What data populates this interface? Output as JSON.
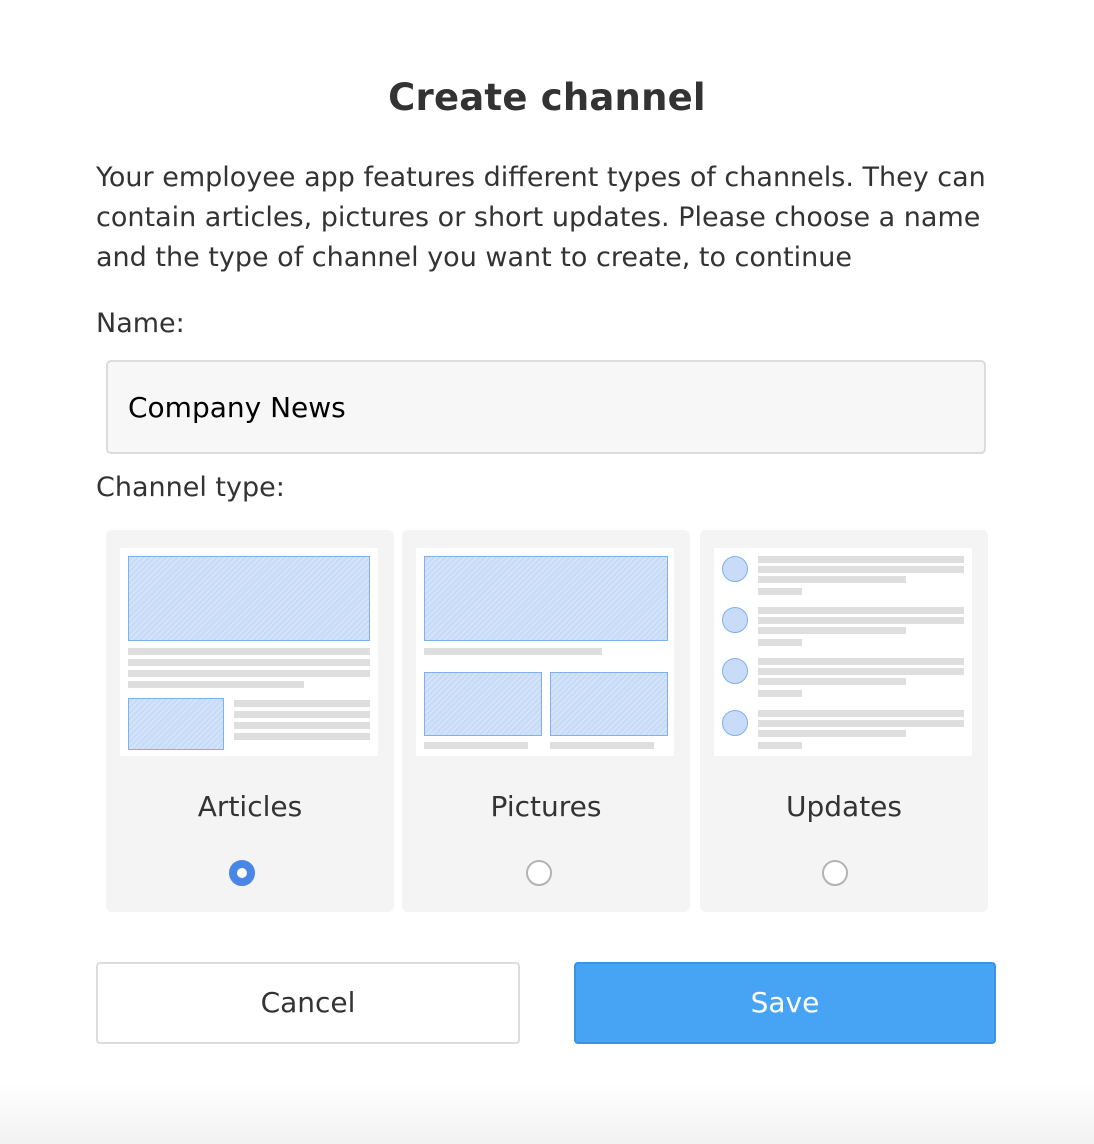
{
  "dialog": {
    "title": "Create channel",
    "description": "Your employee app features different types of channels. They can contain articles, pictures or short updates. Please choose a name and the type of channel you want to create, to continue",
    "name_label": "Name:",
    "name_value": "Company News",
    "channel_type_label": "Channel type:",
    "channel_types": [
      {
        "label": "Articles",
        "selected": true
      },
      {
        "label": "Pictures",
        "selected": false
      },
      {
        "label": "Updates",
        "selected": false
      }
    ],
    "cancel_label": "Cancel",
    "save_label": "Save"
  },
  "colors": {
    "accent": "#4a86e8",
    "save_button": "#47a3f3",
    "card_background": "#f4f4f4",
    "placeholder_image": "#c8dcf7"
  }
}
